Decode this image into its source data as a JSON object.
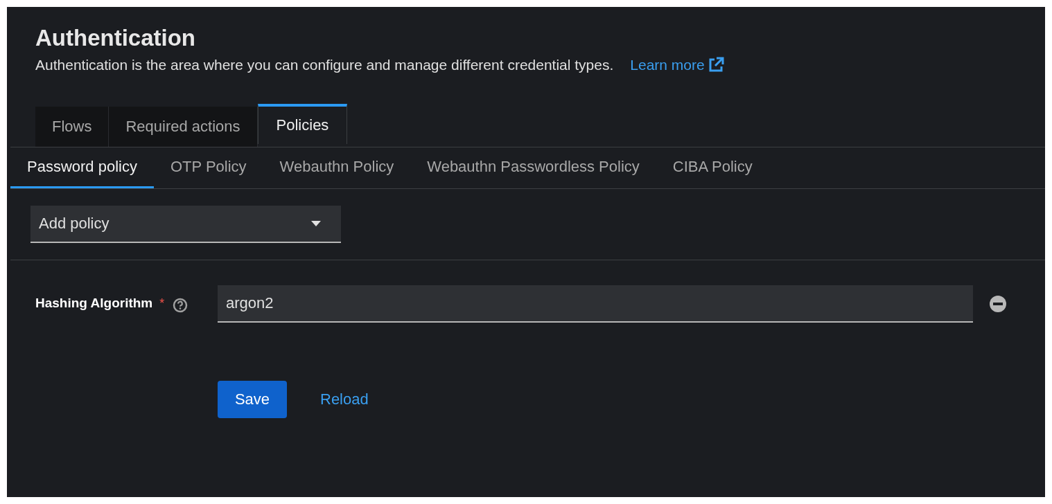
{
  "header": {
    "title": "Authentication",
    "description": "Authentication is the area where you can configure and manage different credential types.",
    "learn_more": "Learn more"
  },
  "tabs": [
    {
      "label": "Flows",
      "selected": false
    },
    {
      "label": "Required actions",
      "selected": false
    },
    {
      "label": "Policies",
      "selected": true
    }
  ],
  "subtabs": [
    {
      "label": "Password policy",
      "selected": true
    },
    {
      "label": "OTP Policy",
      "selected": false
    },
    {
      "label": "Webauthn Policy",
      "selected": false
    },
    {
      "label": "Webauthn Passwordless Policy",
      "selected": false
    },
    {
      "label": "CIBA Policy",
      "selected": false
    }
  ],
  "add_policy": {
    "value": "Add policy"
  },
  "policies": [
    {
      "label": "Hashing Algorithm",
      "required_mark": "*",
      "value": "argon2"
    }
  ],
  "buttons": {
    "save": "Save",
    "reload": "Reload"
  }
}
